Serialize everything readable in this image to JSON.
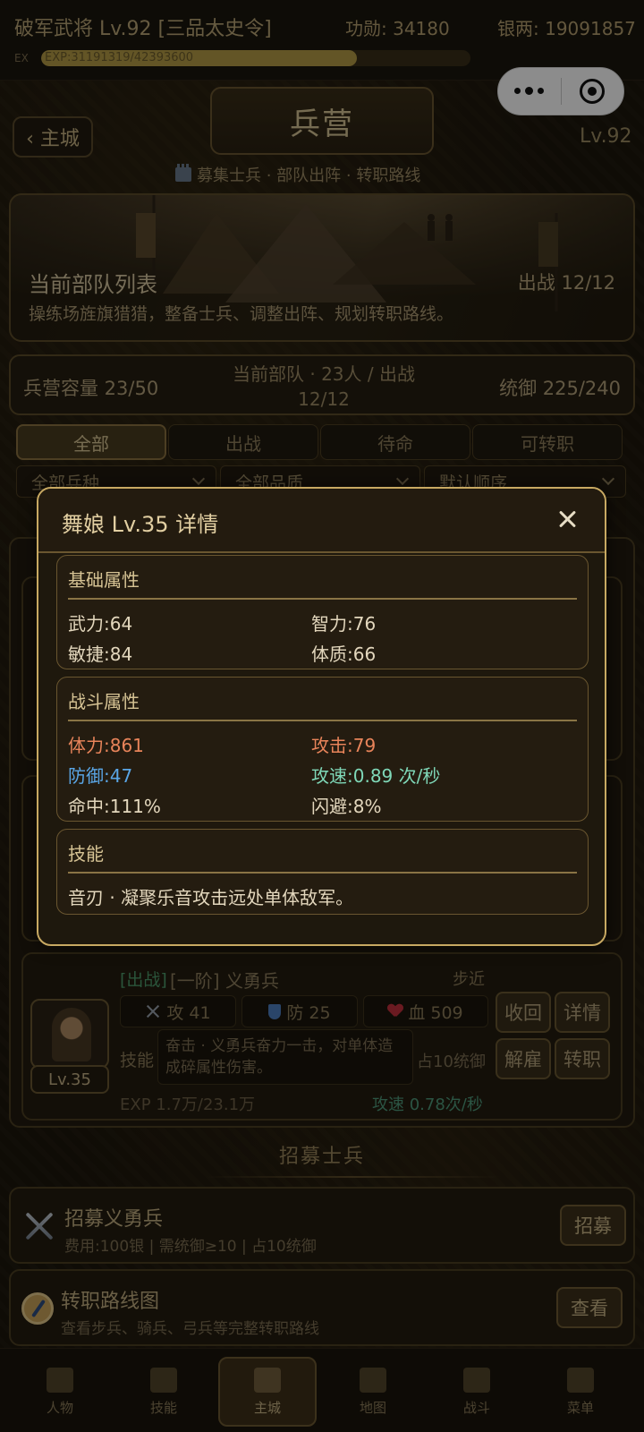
{
  "topbar": {
    "title": "破军武将 Lv.92 [三品太史令]",
    "merit": "功勋: 34180",
    "silver": "银两: 19091857",
    "ex_label": "EX",
    "exp_text": "EXP:3119131​9/42393600",
    "exp_progress": 0.736
  },
  "header": {
    "back_label": "‹ 主城",
    "title": "兵营",
    "level": "Lv.92",
    "subtitle": "募集士兵 · 部队出阵 · 转职路线"
  },
  "banner": {
    "title": "当前部队列表",
    "deploy": "出战 12/12",
    "desc": "操练场旌旗猎猎，整备士兵、调整出阵、规划转职路线。"
  },
  "stats": {
    "capacity": "兵营容量 23/50",
    "current": "当前部队 · 23人 / 出战12/12",
    "command": "统御 225/240"
  },
  "tabs": [
    "全部",
    "出战",
    "待命",
    "可转职"
  ],
  "filters": {
    "type": "全部兵种",
    "quality": "全部品质",
    "order": "默认顺序"
  },
  "modal": {
    "title": "舞娘 Lv.35 详情",
    "basic": {
      "title": "基础属性",
      "str": "武力:64",
      "int": "智力:76",
      "agi": "敏捷:84",
      "con": "体质:66"
    },
    "combat": {
      "title": "战斗属性",
      "hp": "体力:861",
      "atk": "攻击:79",
      "def": "防御:47",
      "spd": "攻速:0.89 次/秒",
      "hit": "命中:111%",
      "dodge": "闪避:8%",
      "colors": {
        "hp": "#e8845a",
        "atk": "#e8845a",
        "def": "#5aa6e6",
        "spd": "#7fd8b8"
      }
    },
    "skill": {
      "title": "技能",
      "desc": "音刃 · 凝聚乐音攻击远处单体敌军。"
    }
  },
  "soldier": {
    "status": "[出战]",
    "name": "[一阶] 义勇兵",
    "class": "步近",
    "atk": "攻 41",
    "def": "防 25",
    "hp": "血 509",
    "skill_label": "技能",
    "skill_desc": "奋击 · 义勇兵奋力一击，对单体造成碎属性伤害。",
    "cmd_cost": "占10统御",
    "level": "Lv.35",
    "exp": "EXP 1.7万/23.1万",
    "speed": "攻速 0.78次/秒",
    "actions": {
      "recall": "收回",
      "detail": "详情",
      "dismiss": "解雇",
      "promote": "转职"
    }
  },
  "recruit": {
    "section_title": "招募士兵",
    "militia": {
      "title": "招募义勇兵",
      "sub": "费用:100银 | 需统御≥10 | 占10统御",
      "btn": "招募"
    },
    "route": {
      "title": "转职路线图",
      "sub": "查看步兵、骑兵、弓兵等完整转职路线",
      "btn": "查看"
    }
  },
  "nav": {
    "items": [
      "人物",
      "技能",
      "主城",
      "地图",
      "战斗",
      "菜单"
    ]
  }
}
